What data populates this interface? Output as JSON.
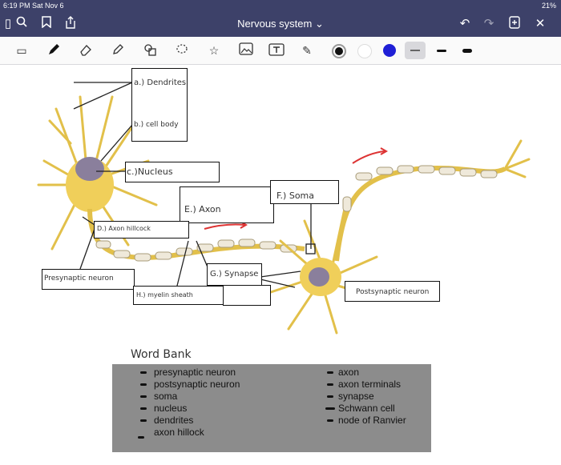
{
  "status": {
    "time": "6:19 PM  Sat Nov 6",
    "battery": "21%"
  },
  "document": {
    "title": "Nervous system ⌄"
  },
  "toolbar": {
    "colors": {
      "black": "#111111",
      "white": "#ffffff",
      "blue": "#1f1fd6",
      "gray": "#cfcfcf"
    }
  },
  "labels": {
    "dendrites": "a.) Dendrites",
    "cell_body": "b.) cell body",
    "nucleus": "c.)Nucleus",
    "axon_hillock": "D.) Axon hillcock",
    "axon": "E.) Axon",
    "soma": "F.) Soma",
    "synapse": "G.) Synapse",
    "myelin": "H.) myelin sheath",
    "presynaptic": "Presynaptic neuron",
    "postsynaptic": "Postsynaptic neuron"
  },
  "word_bank": {
    "title": "Word Bank",
    "left": [
      "presynaptic neuron",
      "postsynaptic neuron",
      "soma",
      "nucleus",
      "dendrites",
      "axon hillock"
    ],
    "right": [
      "axon",
      "axon terminals",
      "synapse",
      "Schwann cell",
      "node of Ranvier"
    ]
  }
}
